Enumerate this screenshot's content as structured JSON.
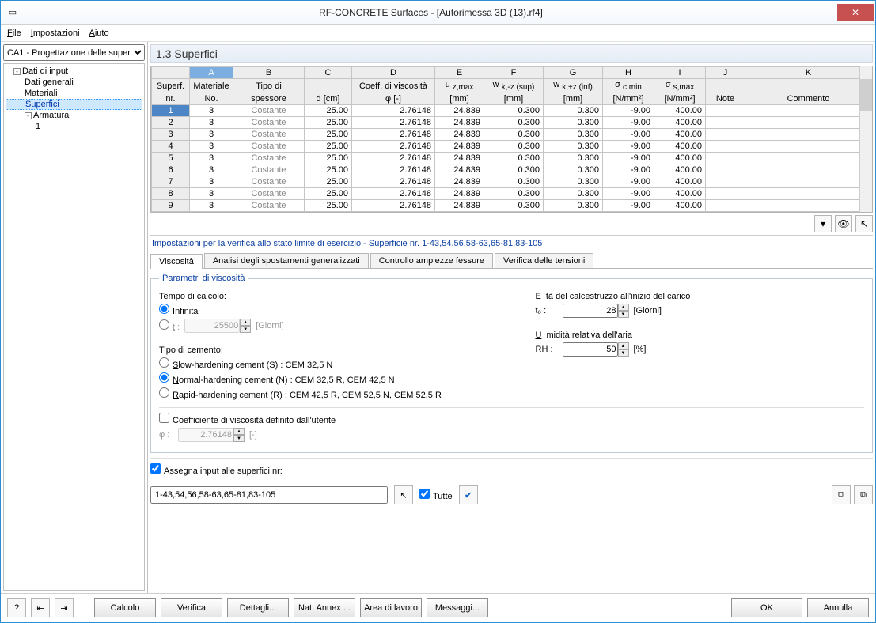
{
  "window": {
    "title": "RF-CONCRETE Surfaces - [Autorimessa 3D (13).rf4]",
    "close": "✕"
  },
  "menu": {
    "file": "File",
    "settings": "Impostazioni",
    "help": "Aiuto"
  },
  "sidebar": {
    "dropdown": "CA1 - Progettazione delle superf",
    "tree": {
      "input_data": "Dati di input",
      "general_data": "Dati generali",
      "materials": "Materiali",
      "surfaces": "Superfici",
      "reinforcement": "Armatura",
      "reinf_1": "1"
    }
  },
  "section_title": "1.3 Superfici",
  "columns": {
    "row": {
      "l1": "Superf.",
      "l2": "nr."
    },
    "A": {
      "l1": "Materiale",
      "l2": "No."
    },
    "B": {
      "l1": "Tipo di",
      "l2": "spessore"
    },
    "C": {
      "l1": "",
      "l2": "d [cm]"
    },
    "D": {
      "l1": "Coeff. di viscosità",
      "l2": "φ [-]"
    },
    "E": {
      "l1": "u z,max",
      "l2": "[mm]"
    },
    "F": {
      "l1": "w k,-z (sup)",
      "l2": "[mm]"
    },
    "G": {
      "l1": "w k,+z (inf)",
      "l2": "[mm]"
    },
    "H": {
      "l1": "σ c,min",
      "l2": "[N/mm²]"
    },
    "I": {
      "l1": "σ s,max",
      "l2": "[N/mm²]"
    },
    "J": {
      "l1": "",
      "l2": "Note"
    },
    "K": {
      "l1": "",
      "l2": "Commento"
    }
  },
  "colLetters": {
    "A": "A",
    "B": "B",
    "C": "C",
    "D": "D",
    "E": "E",
    "F": "F",
    "G": "G",
    "H": "H",
    "I": "I",
    "J": "J",
    "K": "K"
  },
  "rows": [
    {
      "n": "1",
      "mat": "3",
      "tipo": "Costante",
      "d": "25.00",
      "phi": "2.76148",
      "uz": "24.839",
      "wkn": "0.300",
      "wkp": "0.300",
      "sc": "-9.00",
      "ss": "400.00"
    },
    {
      "n": "2",
      "mat": "3",
      "tipo": "Costante",
      "d": "25.00",
      "phi": "2.76148",
      "uz": "24.839",
      "wkn": "0.300",
      "wkp": "0.300",
      "sc": "-9.00",
      "ss": "400.00"
    },
    {
      "n": "3",
      "mat": "3",
      "tipo": "Costante",
      "d": "25.00",
      "phi": "2.76148",
      "uz": "24.839",
      "wkn": "0.300",
      "wkp": "0.300",
      "sc": "-9.00",
      "ss": "400.00"
    },
    {
      "n": "4",
      "mat": "3",
      "tipo": "Costante",
      "d": "25.00",
      "phi": "2.76148",
      "uz": "24.839",
      "wkn": "0.300",
      "wkp": "0.300",
      "sc": "-9.00",
      "ss": "400.00"
    },
    {
      "n": "5",
      "mat": "3",
      "tipo": "Costante",
      "d": "25.00",
      "phi": "2.76148",
      "uz": "24.839",
      "wkn": "0.300",
      "wkp": "0.300",
      "sc": "-9.00",
      "ss": "400.00"
    },
    {
      "n": "6",
      "mat": "3",
      "tipo": "Costante",
      "d": "25.00",
      "phi": "2.76148",
      "uz": "24.839",
      "wkn": "0.300",
      "wkp": "0.300",
      "sc": "-9.00",
      "ss": "400.00"
    },
    {
      "n": "7",
      "mat": "3",
      "tipo": "Costante",
      "d": "25.00",
      "phi": "2.76148",
      "uz": "24.839",
      "wkn": "0.300",
      "wkp": "0.300",
      "sc": "-9.00",
      "ss": "400.00"
    },
    {
      "n": "8",
      "mat": "3",
      "tipo": "Costante",
      "d": "25.00",
      "phi": "2.76148",
      "uz": "24.839",
      "wkn": "0.300",
      "wkp": "0.300",
      "sc": "-9.00",
      "ss": "400.00"
    },
    {
      "n": "9",
      "mat": "3",
      "tipo": "Costante",
      "d": "25.00",
      "phi": "2.76148",
      "uz": "24.839",
      "wkn": "0.300",
      "wkp": "0.300",
      "sc": "-9.00",
      "ss": "400.00"
    }
  ],
  "settings_title": "Impostazioni per la verifica allo stato limite di esercizio - Superficie nr. 1-43,54,56,58-63,65-81,83-105",
  "tabs": {
    "viscosita": "Viscosità",
    "analisi": "Analisi degli spostamenti generalizzati",
    "controllo": "Controllo ampiezze fessure",
    "verifica": "Verifica delle tensioni"
  },
  "params": {
    "legend": "Parametri di viscosità",
    "tempo_label": "Tempo di calcolo:",
    "infinita": "Infinita",
    "t_label": "t :",
    "t_value": "25500",
    "giorni": "[Giorni]",
    "tipo_cemento": "Tipo di cemento:",
    "cem_s": "Slow-hardening cement (S) : CEM 32,5 N",
    "cem_n": "Normal-hardening cement (N) : CEM 32,5 R, CEM 42,5 N",
    "cem_r": "Rapid-hardening cement (R) : CEM 42,5 R, CEM 52,5 N, CEM 52,5 R",
    "eta_label": "Età del calcestruzzo all'inizio del carico",
    "t0_label": "t₀ :",
    "t0_value": "28",
    "umidita_label": "Umidità relativa dell'aria",
    "rh_label": "RH :",
    "rh_value": "50",
    "percent": "[%]",
    "coef_user": "Coefficiente di viscosità definito dall'utente",
    "phi_label": "φ :",
    "phi_value": "2.76148",
    "dimless": "[-]"
  },
  "assign": {
    "check_label": "Assegna input alle superfici nr:",
    "value": "1-43,54,56,58-63,65-81,83-105",
    "tutte": "Tutte"
  },
  "footer": {
    "calcolo": "Calcolo",
    "verifica": "Verifica",
    "dettagli": "Dettagli...",
    "nat_annex": "Nat. Annex ...",
    "area": "Area di lavoro",
    "messaggi": "Messaggi...",
    "ok": "OK",
    "annulla": "Annulla"
  }
}
